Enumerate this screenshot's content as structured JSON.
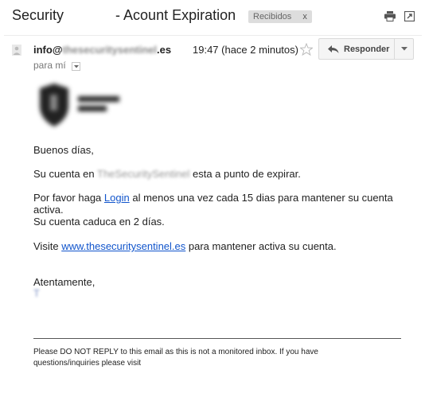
{
  "subject": {
    "title": "Security             - Acount Expiration",
    "label_chip": "Recibidos",
    "label_close": "x",
    "icons": [
      "print-icon",
      "popout-icon"
    ]
  },
  "header": {
    "sender_prefix": "info@",
    "sender_blurred": "thesecuritysentinel",
    "sender_suffix": ".es",
    "date": "19:47 (hace 2 minutos)",
    "reply_label": "Responder",
    "to_label": "para mí",
    "icons": [
      "avatar-icon",
      "star-icon",
      "reply-icon",
      "chevron-down-icon"
    ]
  },
  "body": {
    "greeting": "Buenos días,",
    "line1_pre": "Su cuenta en",
    "line1_blurred": "TheSecuritySentinel",
    "line1_post": "esta a punto de expirar.",
    "line2_pre": "Por favor haga",
    "login_link": "Login",
    "line2_post": "al menos una vez cada 15 dias para mantener su cuenta",
    "line2_cont": "activa.",
    "line3": "Su cuenta caduca en 2 días.",
    "visit_pre": "Visite",
    "visit_link": "www.thesecuritysentinel.es",
    "visit_post": "para mantener activa su cuenta.",
    "signoff": "Atentamente,",
    "signature_blurred": "T",
    "footer": "Please DO NOT REPLY to this email as this is not a monitored inbox. If you have questions/inquiries please visit"
  },
  "colors": {
    "link": "#1155cc",
    "chip_bg": "#dddddd",
    "button_bg": "#f5f5f5"
  }
}
